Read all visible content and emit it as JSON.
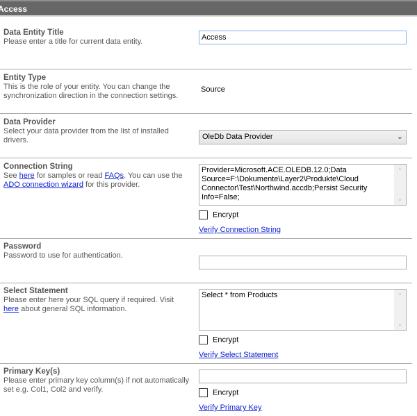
{
  "header": {
    "title": "Access"
  },
  "sections": {
    "title": {
      "label": "Data Entity Title",
      "description": "Please enter a title for current data entity.",
      "value": "Access"
    },
    "entity_type": {
      "label": "Entity Type",
      "description": "This is the role of your entity. You can change the synchronization direction in the connection settings.",
      "value": "Source"
    },
    "data_provider": {
      "label": "Data Provider",
      "description": "Select your data provider from the list of installed drivers.",
      "selected": "OleDb Data Provider"
    },
    "connection_string": {
      "label": "Connection String",
      "desc_part1": "See ",
      "link_here": "here",
      "desc_part2": " for samples or read ",
      "link_faqs": "FAQs",
      "desc_part3": ". You can use the ",
      "link_wizard": "ADO connection wizard",
      "desc_part4": " for this provider.",
      "value": "Provider=Microsoft.ACE.OLEDB.12.0;Data Source=F:\\Dokumente\\Layer2\\Produkte\\Cloud Connector\\Test\\Northwind.accdb;Persist Security Info=False;",
      "encrypt_label": "Encrypt",
      "verify_label": "Verify Connection String"
    },
    "password": {
      "label": "Password",
      "description": "Password to use for authentication.",
      "value": ""
    },
    "select_statement": {
      "label": "Select Statement",
      "desc_part1": "Please enter here your SQL query if required. Visit ",
      "link_here": "here",
      "desc_part2": " about general SQL information.",
      "value": "Select * from Products",
      "encrypt_label": "Encrypt",
      "verify_label": "Verify Select Statement"
    },
    "primary_key": {
      "label": "Primary Key(s)",
      "description": "Please enter primary key column(s) if not automatically set e.g. Col1, Col2 and verify.",
      "value": "",
      "encrypt_label": "Encrypt",
      "verify_label": "Verify Primary Key"
    }
  },
  "icons": {
    "scroll_up": "▲",
    "scroll_down": "▼",
    "dropdown": "⌄"
  }
}
